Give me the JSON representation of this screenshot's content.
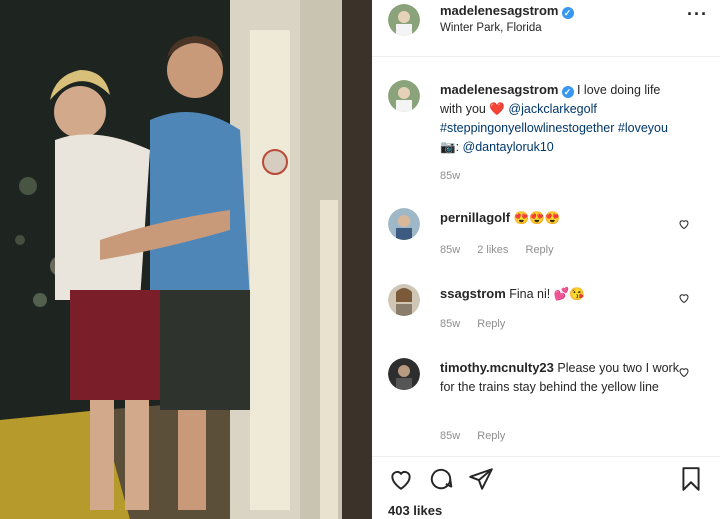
{
  "post": {
    "author": "madelenesagstrom",
    "location": "Winter Park, Florida",
    "more_icon": "···"
  },
  "caption": {
    "username": "madelenesagstrom",
    "text_1": "I love doing life with you",
    "heart_emoji": "❤️",
    "mention_1": "@jackclarkegolf",
    "hashtag_1": "#steppingonyellowlinestogether",
    "hashtag_2": "#loveyou",
    "camera_emoji": "📷:",
    "mention_2": "@dantayloruk10",
    "time": "85w"
  },
  "comments": [
    {
      "username": "pernillagolf",
      "text": "😍😍😍",
      "time": "85w",
      "likes": "2 likes",
      "reply": "Reply"
    },
    {
      "username": "ssagstrom",
      "text": "Fina ni! 💕😘",
      "time": "85w",
      "reply": "Reply"
    },
    {
      "username": "timothy.mcnulty23",
      "text": "Please you two I work for the trains stay behind the yellow line",
      "time": "85w",
      "reply": "Reply"
    }
  ],
  "likes_count": "403 likes",
  "colors": {
    "verified": "#3897f0",
    "link": "#00376b",
    "muted": "#8e8e8e",
    "text": "#262626"
  },
  "icons": [
    "heart-icon",
    "comment-icon",
    "share-icon",
    "bookmark-icon",
    "verified-badge-icon",
    "more-options-icon"
  ]
}
